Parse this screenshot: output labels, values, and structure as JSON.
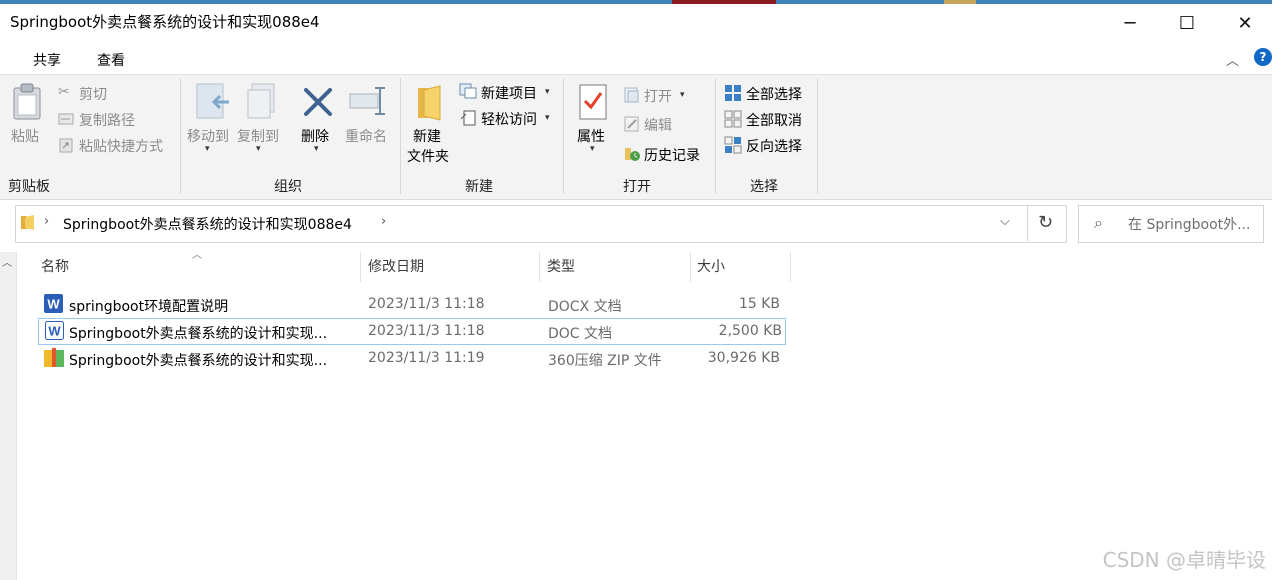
{
  "window": {
    "title": "Springboot外卖点餐系统的设计和实现088e4",
    "controls": {
      "minimize": "─",
      "maximize": "☐",
      "close": "✕"
    }
  },
  "menu": {
    "tabs": [
      "共享",
      "查看"
    ],
    "help": "?"
  },
  "ribbon": {
    "clipboard": {
      "paste": "粘贴",
      "cut": "剪切",
      "copy_path": "复制路径",
      "paste_shortcut": "粘贴快捷方式",
      "label": "剪贴板"
    },
    "organize": {
      "move_to": "移动到",
      "copy_to": "复制到",
      "delete": "删除",
      "rename": "重命名",
      "label": "组织"
    },
    "new": {
      "new_folder_line1": "新建",
      "new_folder_line2": "文件夹",
      "new_item": "新建项目",
      "easy_access": "轻松访问",
      "label": "新建"
    },
    "open": {
      "properties": "属性",
      "open": "打开",
      "edit": "编辑",
      "history": "历史记录",
      "label": "打开"
    },
    "select": {
      "select_all": "全部选择",
      "select_none": "全部取消",
      "invert": "反向选择",
      "label": "选择"
    }
  },
  "address": {
    "path": "Springboot外卖点餐系统的设计和实现088e4",
    "search_placeholder": "在 Springboot外..."
  },
  "list": {
    "columns": {
      "name": "名称",
      "date": "修改日期",
      "type": "类型",
      "size": "大小"
    },
    "files": [
      {
        "name": "springboot环境配置说明",
        "date": "2023/11/3 11:18",
        "type": "DOCX 文档",
        "size": "15 KB",
        "icon": "word-doc-icon"
      },
      {
        "name": "Springboot外卖点餐系统的设计和实现...",
        "date": "2023/11/3 11:18",
        "type": "DOC 文档",
        "size": "2,500 KB",
        "icon": "word-doc-icon"
      },
      {
        "name": "Springboot外卖点餐系统的设计和实现...",
        "date": "2023/11/3 11:19",
        "type": "360压缩 ZIP 文件",
        "size": "30,926 KB",
        "icon": "zip-archive-icon"
      }
    ]
  },
  "watermark": "CSDN @卓晴毕设"
}
